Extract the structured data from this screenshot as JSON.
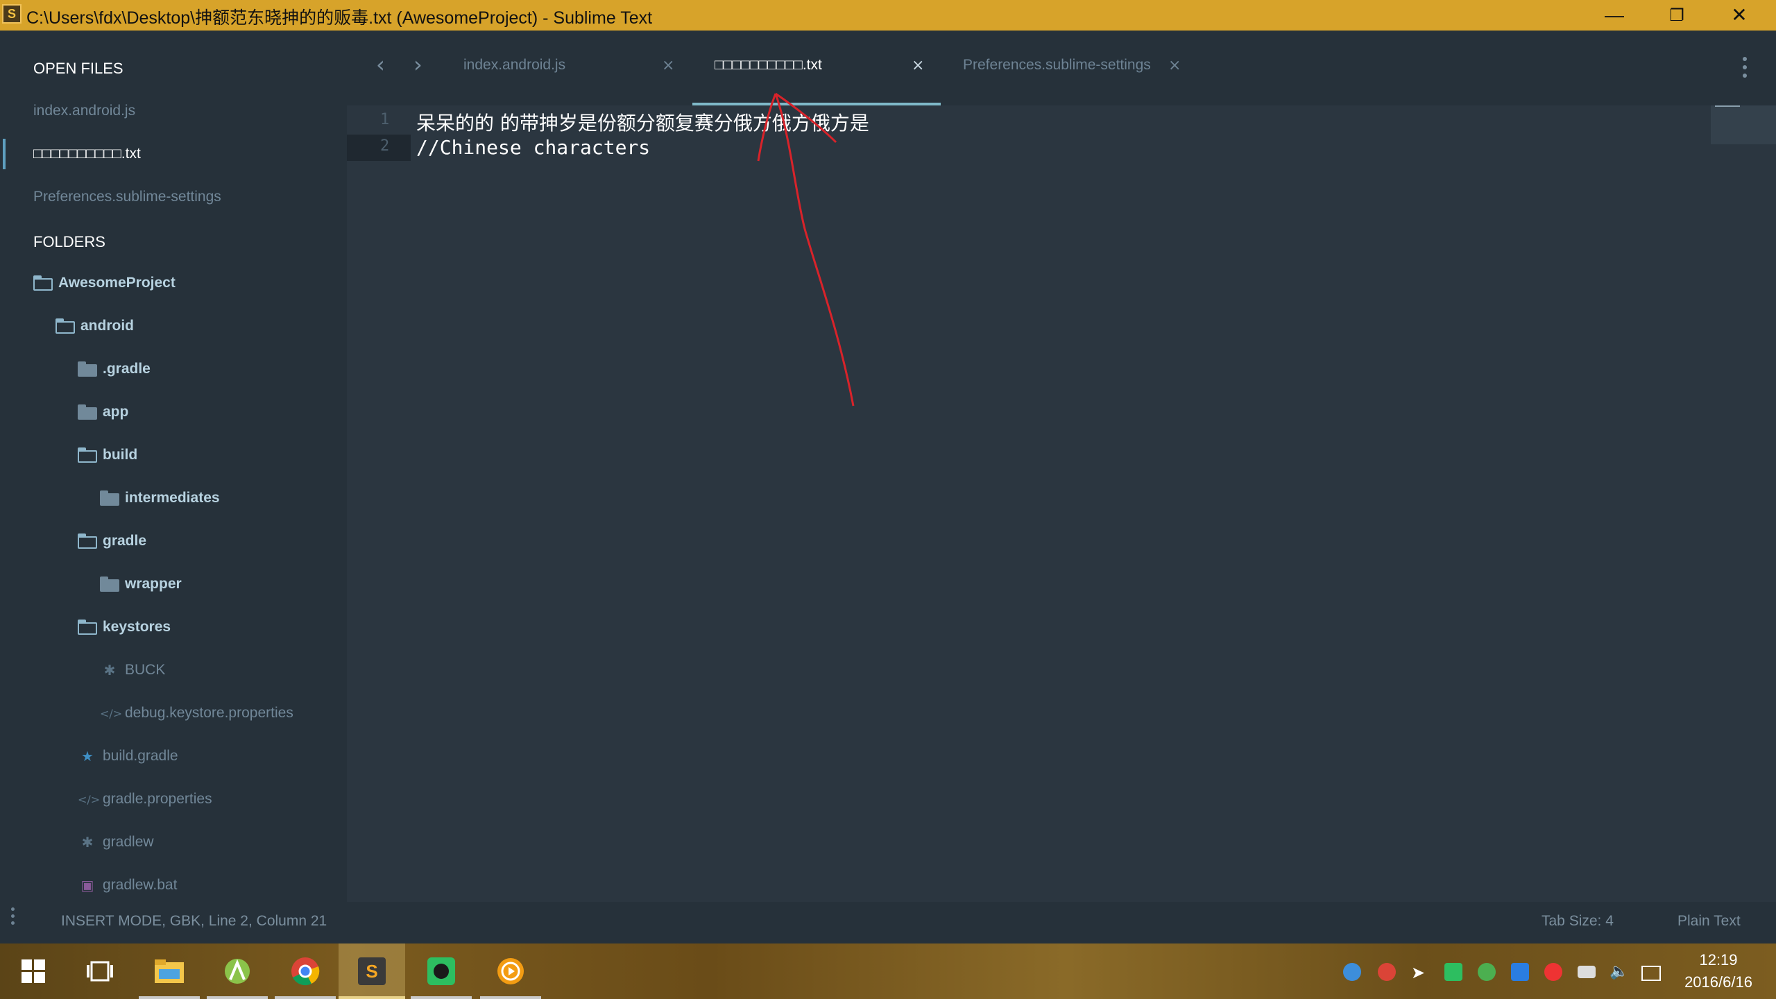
{
  "window": {
    "title": "C:\\Users\\fdx\\Desktop\\抻额范东晓抻的的贩毒.txt (AwesomeProject) - Sublime Text",
    "app_icon_letter": "S",
    "minimize": "—",
    "restore": "❐",
    "close": "✕"
  },
  "sidebar": {
    "open_files_heading": "OPEN FILES",
    "open_files": [
      {
        "label": "index.android.js",
        "active": false
      },
      {
        "label": "□□□□□□□□□□.txt",
        "active": true
      },
      {
        "label": "Preferences.sublime-settings",
        "active": false
      }
    ],
    "folders_heading": "FOLDERS",
    "tree": [
      {
        "label": "AwesomeProject",
        "kind": "folder-open",
        "depth": 0
      },
      {
        "label": "android",
        "kind": "folder-open",
        "depth": 1
      },
      {
        "label": ".gradle",
        "kind": "folder-closed",
        "depth": 2
      },
      {
        "label": "app",
        "kind": "folder-closed",
        "depth": 2
      },
      {
        "label": "build",
        "kind": "folder-open",
        "depth": 2
      },
      {
        "label": "intermediates",
        "kind": "folder-closed",
        "depth": 3
      },
      {
        "label": "gradle",
        "kind": "folder-open",
        "depth": 2
      },
      {
        "label": "wrapper",
        "kind": "folder-closed",
        "depth": 3
      },
      {
        "label": "keystores",
        "kind": "folder-open",
        "depth": 2
      },
      {
        "label": "BUCK",
        "kind": "file-asterisk",
        "depth": 3
      },
      {
        "label": "debug.keystore.properties",
        "kind": "file-code",
        "depth": 3
      },
      {
        "label": "build.gradle",
        "kind": "file-star",
        "depth": 2
      },
      {
        "label": "gradle.properties",
        "kind": "file-code",
        "depth": 2
      },
      {
        "label": "gradlew",
        "kind": "file-asterisk",
        "depth": 2
      },
      {
        "label": "gradlew.bat",
        "kind": "file-terminal",
        "depth": 2
      }
    ]
  },
  "tabs": [
    {
      "label": "index.android.js",
      "active": false
    },
    {
      "label": "□□□□□□□□□□.txt",
      "active": true
    },
    {
      "label": "Preferences.sublime-settings",
      "active": false
    }
  ],
  "nav": {
    "back": "‹",
    "forward": "›"
  },
  "editor": {
    "lines": [
      {
        "number": "1",
        "text": "呆呆的的 的带抻岁是份额分额复赛分俄方俄方俄方是"
      },
      {
        "number": "2",
        "text": "//Chinese characters"
      }
    ]
  },
  "status": {
    "left": "INSERT MODE, GBK, Line 2, Column 21",
    "tab_size": "Tab Size: 4",
    "syntax": "Plain Text"
  },
  "taskbar": {
    "time": "12:19",
    "date": "2016/6/16",
    "apps": [
      "start-icon",
      "task-view-icon",
      "file-explorer-icon",
      "android-studio-icon",
      "chrome-icon",
      "sublime-text-icon",
      "evernote-icon",
      "media-player-icon"
    ]
  },
  "colors": {
    "titlebar": "#d7a32a",
    "sidebar_bg": "#26313a",
    "editor_bg": "#2b3640",
    "tab_underline": "#7fb9c9",
    "annotation": "#d8232a"
  }
}
